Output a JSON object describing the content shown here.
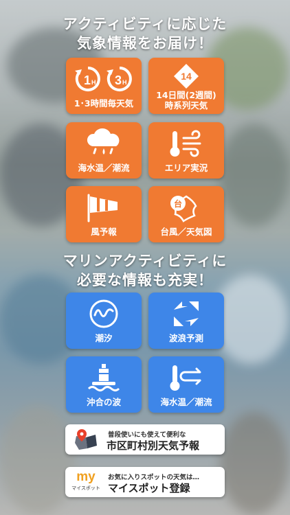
{
  "headline_top": {
    "line1": "アクティビティに応じた",
    "line2": "気象情報をお届け！"
  },
  "orange_tiles": [
    {
      "label": "1･3時間毎天気",
      "icon": "hourly-clock-icon",
      "icon_text_1": "1",
      "icon_sub_1": "H",
      "icon_text_2": "3",
      "icon_sub_2": "H"
    },
    {
      "label_line1": "14日間(2週間)",
      "label_line2": "時系列天気",
      "icon": "calendar-14-icon",
      "icon_text": "14"
    },
    {
      "label": "海水温／潮流",
      "icon": "rain-cloud-icon"
    },
    {
      "label": "エリア実況",
      "icon": "thermometer-wind-icon"
    },
    {
      "label": "風予報",
      "icon": "windsock-icon"
    },
    {
      "label": "台風／天気図",
      "icon": "typhoon-map-icon",
      "icon_text": "台"
    }
  ],
  "headline_bottom": {
    "line1": "マリンアクティビティに",
    "line2": "必要な情報も充実！"
  },
  "blue_tiles": [
    {
      "label": "潮汐",
      "icon": "tide-wave-icon"
    },
    {
      "label": "波浪予測",
      "icon": "wave-arrows-icon"
    },
    {
      "label": "沖合の波",
      "icon": "buoy-icon"
    },
    {
      "label": "海水温／潮流",
      "icon": "thermometer-current-icon"
    }
  ],
  "banners": [
    {
      "small": "普段使いにも使えて便利な",
      "big": "市区町村別天気予報",
      "icon": "city-map-pin-icon"
    },
    {
      "small": "お気に入りスポットの天気は…",
      "big": "マイスポット登録",
      "icon": "my-spot-icon",
      "icon_text": "my",
      "icon_caption": "マイスポット"
    }
  ],
  "colors": {
    "orange": "#f07a32",
    "blue": "#3e86e8",
    "myspot_brand": "#f0a020",
    "pin_red": "#e8402a"
  }
}
